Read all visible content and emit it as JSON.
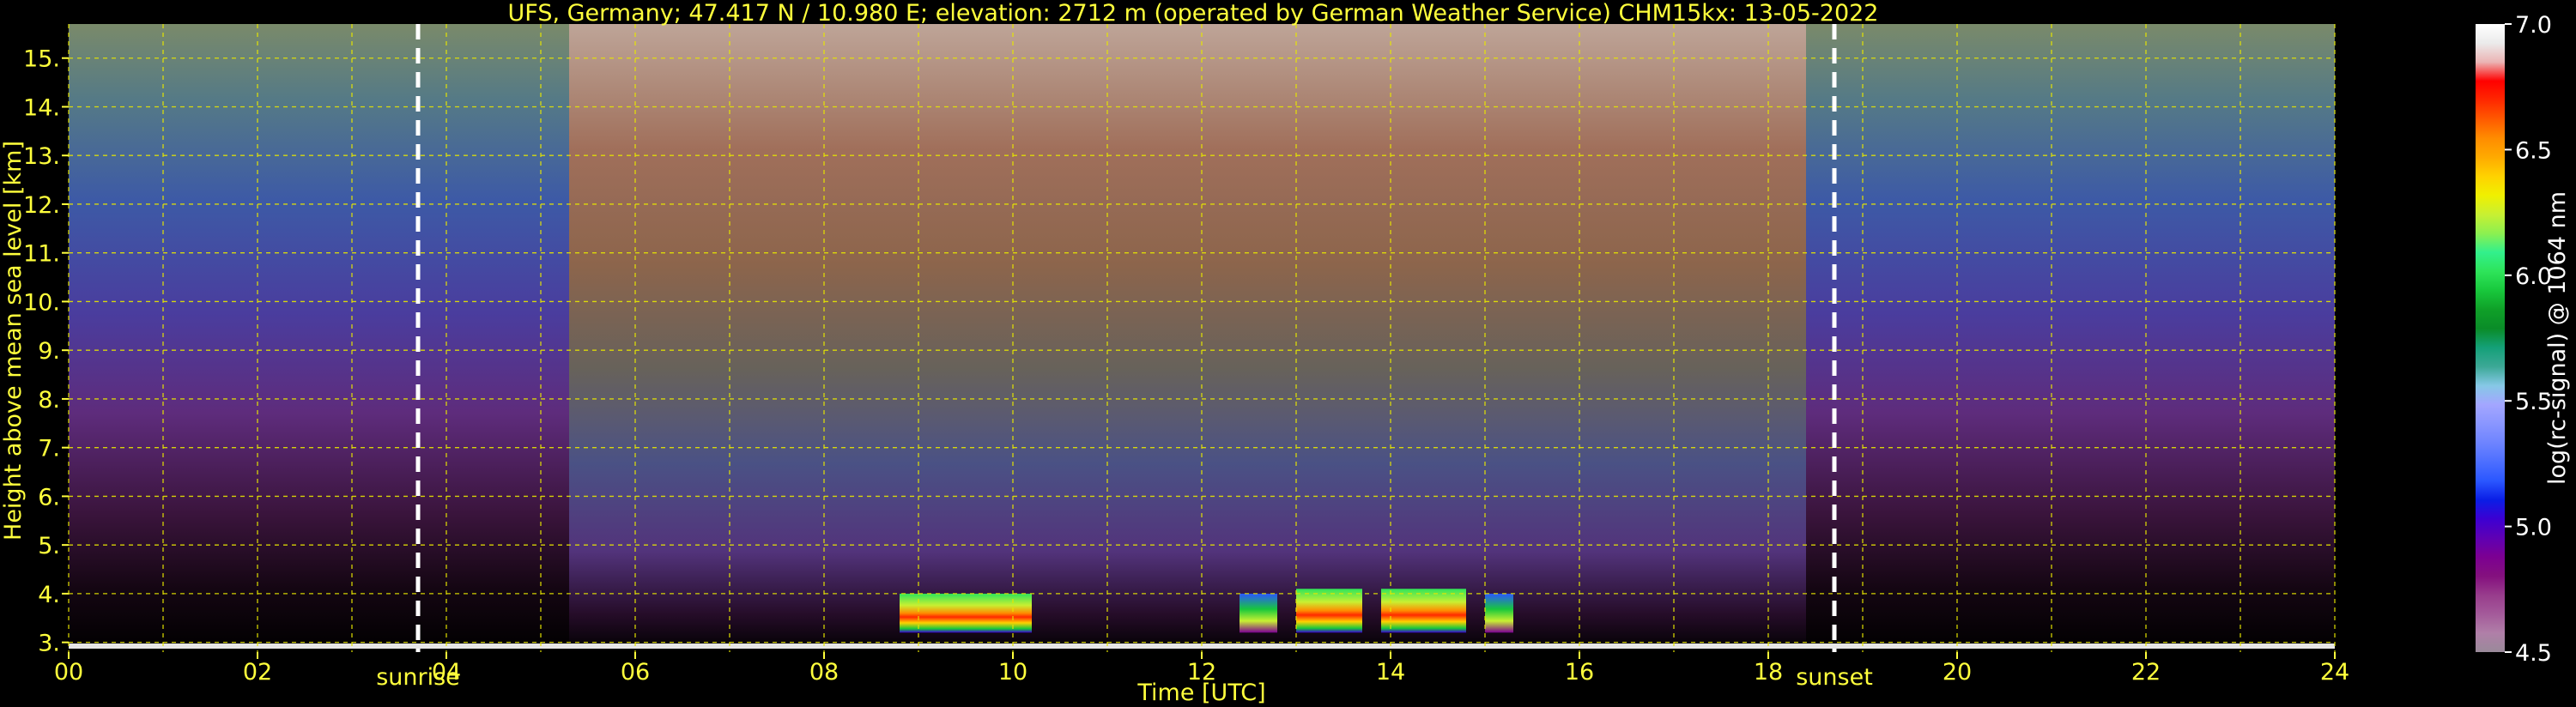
{
  "chart_data": {
    "type": "heatmap",
    "title": "UFS, Germany; 47.417 N / 10.980 E; elevation: 2712 m  (operated by German Weather Service)    CHM15kx: 13-05-2022",
    "xlabel": "Time [UTC]",
    "ylabel": "Height above mean sea level [km]",
    "xlim": [
      0,
      24
    ],
    "ylim": [
      2.8,
      15.7
    ],
    "x_ticks": [
      0,
      2,
      4,
      6,
      8,
      10,
      12,
      14,
      16,
      18,
      20,
      22,
      24
    ],
    "x_tick_labels": [
      "00",
      "02",
      "04",
      "06",
      "08",
      "10",
      "12",
      "14",
      "16",
      "18",
      "20",
      "22",
      "24"
    ],
    "x_minor_gridlines": [
      1,
      3,
      5,
      7,
      9,
      11,
      13,
      15,
      17,
      19,
      21,
      23
    ],
    "y_ticks": [
      3,
      4,
      5,
      6,
      7,
      8,
      9,
      10,
      11,
      12,
      13,
      14,
      15
    ],
    "y_tick_labels": [
      "3.",
      "4.",
      "5.",
      "6.",
      "7.",
      "8.",
      "9.",
      "10.",
      "11.",
      "12.",
      "13.",
      "14.",
      "15."
    ],
    "grid": true,
    "background_color": "#000000",
    "markers": [
      {
        "label": "sunrise",
        "x": 3.7
      },
      {
        "label": "sunset",
        "x": 18.7
      }
    ],
    "colorbar": {
      "label": "log(rc-signal) @ 1064 nm",
      "range": [
        4.5,
        7.0
      ],
      "tick_values": [
        4.5,
        5.0,
        5.5,
        6.0,
        6.5,
        7.0
      ],
      "tick_labels": [
        "4.5",
        "5.0",
        "5.5",
        "6.0",
        "6.5",
        "7.0"
      ],
      "colors": [
        "#9a8a9a",
        "#b07fa8",
        "#a45a9a",
        "#983c8c",
        "#84107e",
        "#7c0092",
        "#5e00b4",
        "#3c00d2",
        "#0a1ee6",
        "#2b57ff",
        "#4d6fff",
        "#6e84ff",
        "#8a96ff",
        "#a3a6ff",
        "#86c8e6",
        "#3ca896",
        "#14a078",
        "#0a8c28",
        "#0fa028",
        "#18c83c",
        "#2ee45a",
        "#32f08c",
        "#8cf050",
        "#c8f032",
        "#f0f000",
        "#ffd200",
        "#ffaa00",
        "#ff8c00",
        "#ff5a00",
        "#ff2800",
        "#ff0000",
        "#ebb4b4",
        "#ebebeb",
        "#ffffff"
      ]
    },
    "cloud_segments": [
      {
        "t0": 8.8,
        "t1": 10.2,
        "z0": 3.2,
        "z1": 4.0,
        "intensity": "high"
      },
      {
        "t0": 12.4,
        "t1": 12.8,
        "z0": 3.2,
        "z1": 4.0,
        "intensity": "medium"
      },
      {
        "t0": 13.0,
        "t1": 13.7,
        "z0": 3.2,
        "z1": 4.1,
        "intensity": "high"
      },
      {
        "t0": 13.9,
        "t1": 14.8,
        "z0": 3.2,
        "z1": 4.1,
        "intensity": "high"
      },
      {
        "t0": 15.0,
        "t1": 15.3,
        "z0": 3.2,
        "z1": 4.0,
        "intensity": "medium"
      }
    ]
  }
}
